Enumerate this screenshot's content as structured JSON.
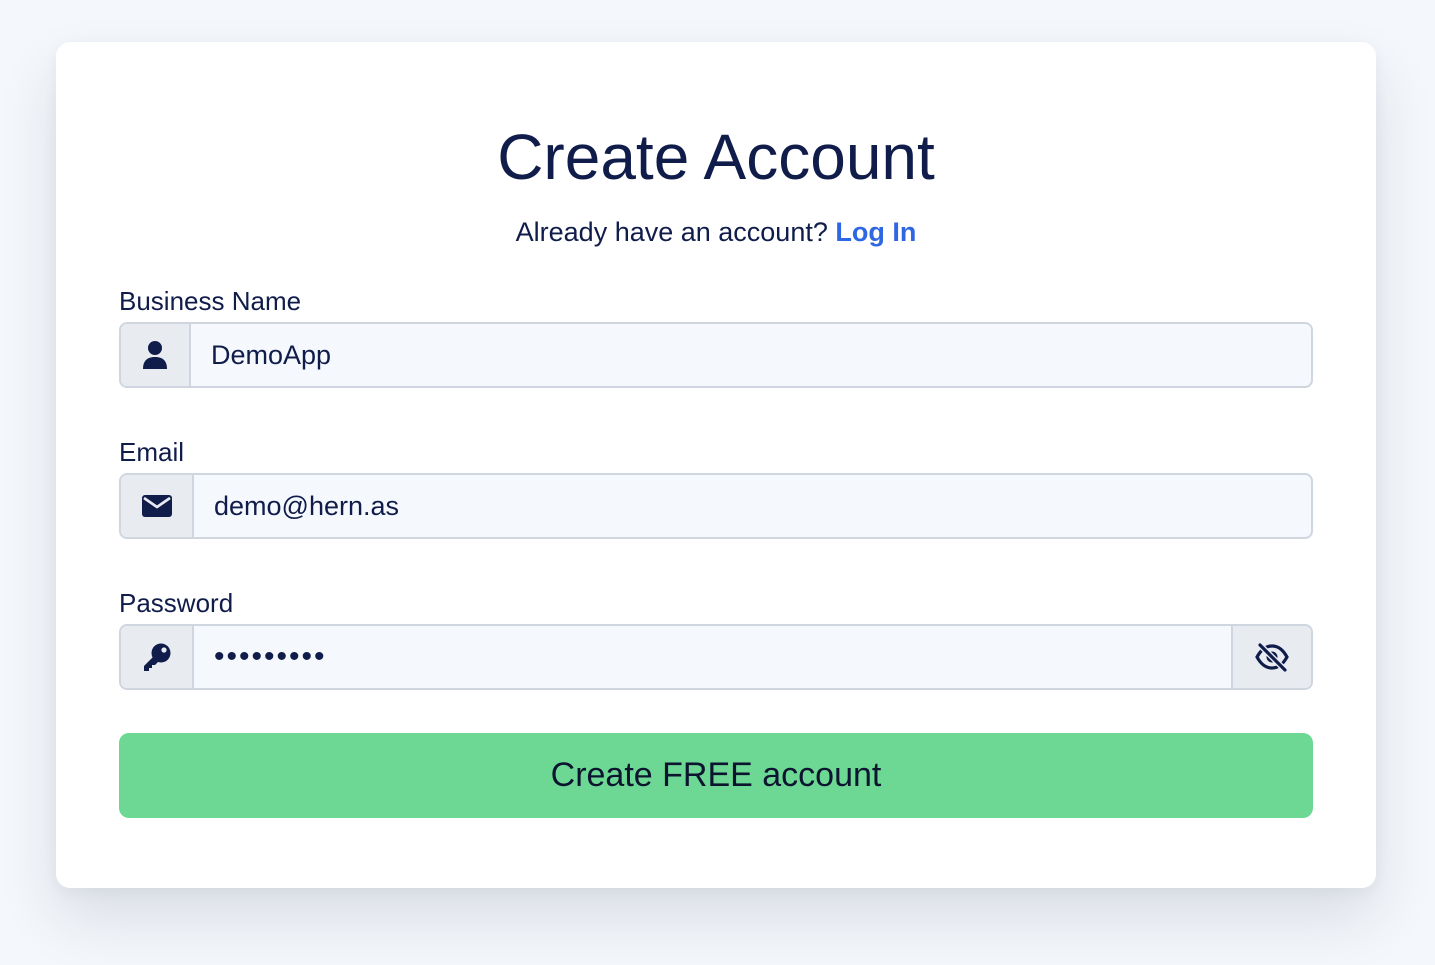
{
  "form": {
    "title": "Create Account",
    "subtitle_prefix": "Already have an account?",
    "login_link": "Log In",
    "business_name": {
      "label": "Business Name",
      "value": "DemoApp",
      "icon": "user-icon"
    },
    "email": {
      "label": "Email",
      "value": "demo@hern.as",
      "icon": "envelope-icon"
    },
    "password": {
      "label": "Password",
      "value": "•••••••••",
      "icon": "key-icon",
      "toggle_icon": "eye-slash-icon"
    },
    "submit_label": "Create FREE account"
  },
  "colors": {
    "background": "#f4f7fb",
    "card": "#ffffff",
    "text": "#101c4a",
    "link": "#2f66e3",
    "submit": "#6cd893",
    "input_bg": "#f5f8fd",
    "addon_bg": "#e8ecf1",
    "border": "#cfd6df"
  }
}
